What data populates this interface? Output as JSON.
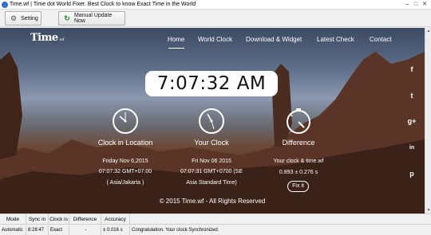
{
  "window": {
    "title": "Time.wf | Time dot World Fixer. Best Clock to know Exact Time in the World",
    "minimize_glyph": "–",
    "maximize_glyph": "□",
    "close_glyph": "✕"
  },
  "toolbar": {
    "setting_label": "Setting",
    "setting_icon": "gear-icon",
    "update_label": "Manual Update Now",
    "update_icon": "refresh-icon"
  },
  "site": {
    "logo_text": "Time",
    "logo_suffix": ".wf",
    "nav": [
      "Home",
      "World Clock",
      "Download & Widget",
      "Latest Check",
      "Contact"
    ],
    "active_nav": "Home",
    "big_clock": "7:07:32 AM",
    "columns": {
      "location": {
        "label": "Clock in Location",
        "line1": "Friday Nov 6,2015",
        "line2": "07:07:32 GMT+07:00",
        "line3": "( Asia/Jakarta )"
      },
      "yours": {
        "label": "Your Clock",
        "line1": "Fri Nov 06 2015",
        "line2": "07:07:31 GMT+0700 (SE",
        "line3": "Asia Standard Time)"
      },
      "difference": {
        "label": "Difference",
        "line1": "Your clock & time.wf",
        "line2": "0.893 ± 0.276 s",
        "fix_label": "Fix it"
      }
    },
    "copyright": "© 2015 Time.wf - All Rights Reserved",
    "social": [
      {
        "icon": "facebook-icon",
        "glyph": "f"
      },
      {
        "icon": "twitter-icon",
        "glyph": "t"
      },
      {
        "icon": "google-plus-icon",
        "glyph": "g+"
      },
      {
        "icon": "linkedin-icon",
        "glyph": "in"
      },
      {
        "icon": "pinterest-icon",
        "glyph": "p"
      }
    ]
  },
  "status": {
    "headers": [
      "Mode",
      "Sync in",
      "Clock is",
      "Difference",
      "Accuracy"
    ],
    "values": [
      "Automatic",
      "8:28:47",
      "Exact",
      "-",
      "± 0.016 s",
      "Congratulation. Your clock Synchronized."
    ]
  },
  "colors": {
    "accent": "#2c8a2c",
    "sky_top": "#3c4a63",
    "rock": "#4a2b1e"
  }
}
